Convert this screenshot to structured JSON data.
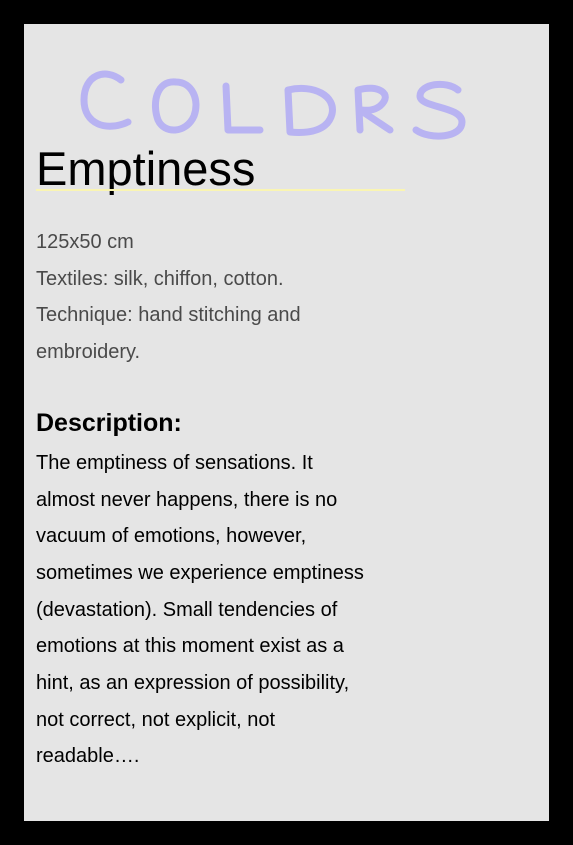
{
  "logo": {
    "text": "COLORS",
    "color": "#b8b3f2"
  },
  "artwork": {
    "title": "Emptiness",
    "underline_color": "#faf5b2",
    "specs": [
      "125x50 cm",
      "Textiles: silk, chiffon, cotton.",
      "Technique: hand stitching and",
      "embroidery."
    ],
    "description_heading": "Description:",
    "description_lines": [
      "The emptiness of sensations. It",
      "almost never happens, there is no",
      "vacuum of emotions, however,",
      "sometimes we experience emptiness",
      "(devastation). Small tendencies of",
      "emotions at this moment exist as a",
      "hint, as an expression of possibility,",
      "not correct, not explicit, not",
      "readable…."
    ]
  },
  "colors": {
    "page_background": "#000000",
    "panel_background": "#e5e5e5",
    "specs_text": "#4a4a4a",
    "body_text": "#000000"
  }
}
